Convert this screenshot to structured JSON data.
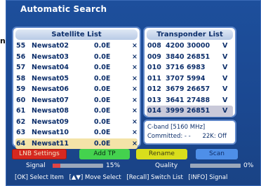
{
  "stray_text": "n",
  "title": "Automatic Search",
  "satellite_list": {
    "header": "Satellite List",
    "rows": [
      {
        "num": "55",
        "name": "Newsat02",
        "pos": "0.0E",
        "mark": "×"
      },
      {
        "num": "56",
        "name": "Newsat03",
        "pos": "0.0E",
        "mark": "×"
      },
      {
        "num": "57",
        "name": "Newsat04",
        "pos": "0.0E",
        "mark": "×"
      },
      {
        "num": "58",
        "name": "Newsat05",
        "pos": "0.0E",
        "mark": "×"
      },
      {
        "num": "59",
        "name": "Newsat06",
        "pos": "0.0E",
        "mark": "×"
      },
      {
        "num": "60",
        "name": "Newsat07",
        "pos": "0.0E",
        "mark": "×"
      },
      {
        "num": "61",
        "name": "Newsat08",
        "pos": "0.0E",
        "mark": "×"
      },
      {
        "num": "62",
        "name": "Newsat09",
        "pos": "0.0E",
        "mark": "×"
      },
      {
        "num": "63",
        "name": "Newsat10",
        "pos": "0.0E",
        "mark": "×"
      },
      {
        "num": "64",
        "name": "Newsat11",
        "pos": "0.0E",
        "mark": "×"
      }
    ],
    "selected_index": 9
  },
  "transponder_list": {
    "header": "Transponder List",
    "rows": [
      {
        "num": "008",
        "freq": "4200",
        "sr": "30000",
        "pol": "V"
      },
      {
        "num": "009",
        "freq": "3840",
        "sr": "26851",
        "pol": "V"
      },
      {
        "num": "010",
        "freq": "3716",
        "sr": "6983",
        "pol": "V"
      },
      {
        "num": "011",
        "freq": "3707",
        "sr": "5994",
        "pol": "V"
      },
      {
        "num": "012",
        "freq": "3679",
        "sr": "26657",
        "pol": "V"
      },
      {
        "num": "013",
        "freq": "3641",
        "sr": "27488",
        "pol": "V"
      },
      {
        "num": "014",
        "freq": "3999",
        "sr": "26851",
        "pol": "V"
      }
    ],
    "selected_index": 6
  },
  "info": {
    "band": "C-band [5160 MHz]",
    "committed": "Committed: - -",
    "khz": "22K: Off"
  },
  "buttons": {
    "lnb": "LNB Settings",
    "add_tp": "Add TP",
    "rename": "Rename",
    "scan": "Scan"
  },
  "signal": {
    "label": "Signal",
    "percent": 15,
    "text": "15%"
  },
  "quality": {
    "label": "Quality",
    "percent": 0,
    "text": "0%"
  },
  "hints": {
    "ok": "[OK] Select Item",
    "move": "[▲▼] Move Select",
    "recall": "[Recall] Switch List",
    "info": "[INFO] Signal"
  },
  "colors": {
    "background": "#1b4891",
    "red": "#d6281f",
    "green": "#44d24e",
    "yellow": "#d9de1c",
    "blue": "#4e8fe8",
    "satellite_selected": "#f4e3a8",
    "transponder_selected": "#c9c9d9"
  }
}
